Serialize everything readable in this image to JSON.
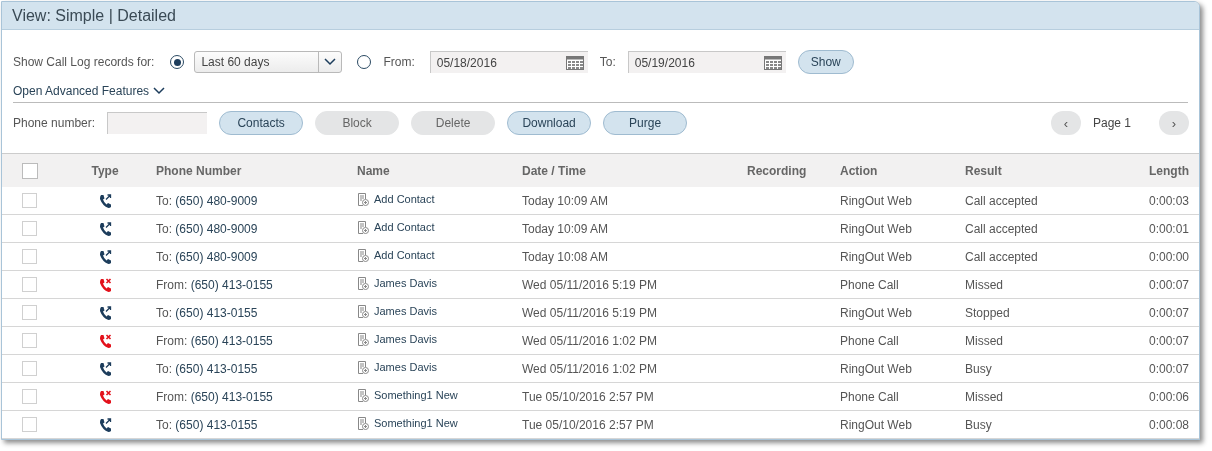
{
  "header": {
    "title": "View: Simple | Detailed"
  },
  "filter": {
    "label": "Show Call Log records for:",
    "range_selected": true,
    "range": "Last 60 days",
    "from_selected": false,
    "from_label": "From:",
    "from": "05/18/2016",
    "to_label": "To:",
    "to": "05/19/2016",
    "show": "Show"
  },
  "advanced": {
    "label": "Open Advanced Features"
  },
  "toolbar": {
    "phone_label": "Phone number:",
    "buttons": [
      {
        "label": "Contacts",
        "disabled": false
      },
      {
        "label": "Block",
        "disabled": true
      },
      {
        "label": "Delete",
        "disabled": true
      },
      {
        "label": "Download",
        "disabled": false
      },
      {
        "label": "Purge",
        "disabled": false
      }
    ],
    "page": "Page 1",
    "prev": "‹",
    "next": "›",
    "prev_disabled": true,
    "next_disabled": true
  },
  "table": {
    "all_checked": false,
    "columns": [
      "Type",
      "Phone Number",
      "Name",
      "Date / Time",
      "Recording",
      "Action",
      "Result",
      "Length"
    ],
    "rows": [
      {
        "checked": false,
        "kind": "outgoing",
        "direction": "To:",
        "number": "(650) 480-9009",
        "name": "Add Contact",
        "datetime": "Today 10:09 AM",
        "action": "RingOut Web",
        "result": "Call accepted",
        "length": "0:00:03"
      },
      {
        "checked": false,
        "kind": "outgoing",
        "direction": "To:",
        "number": "(650) 480-9009",
        "name": "Add Contact",
        "datetime": "Today 10:09 AM",
        "action": "RingOut Web",
        "result": "Call accepted",
        "length": "0:00:01"
      },
      {
        "checked": false,
        "kind": "outgoing",
        "direction": "To:",
        "number": "(650) 480-9009",
        "name": "Add Contact",
        "datetime": "Today 10:08 AM",
        "action": "RingOut Web",
        "result": "Call accepted",
        "length": "0:00:00"
      },
      {
        "checked": false,
        "kind": "missed",
        "direction": "From:",
        "number": "(650) 413-0155",
        "name": "James Davis",
        "datetime": "Wed 05/11/2016 5:19 PM",
        "action": "Phone Call",
        "result": "Missed",
        "length": "0:00:07"
      },
      {
        "checked": false,
        "kind": "outgoing",
        "direction": "To:",
        "number": "(650) 413-0155",
        "name": "James Davis",
        "datetime": "Wed 05/11/2016 5:19 PM",
        "action": "RingOut Web",
        "result": "Stopped",
        "length": "0:00:07"
      },
      {
        "checked": false,
        "kind": "missed",
        "direction": "From:",
        "number": "(650) 413-0155",
        "name": "James Davis",
        "datetime": "Wed 05/11/2016 1:02 PM",
        "action": "Phone Call",
        "result": "Missed",
        "length": "0:00:07"
      },
      {
        "checked": false,
        "kind": "outgoing",
        "direction": "To:",
        "number": "(650) 413-0155",
        "name": "James Davis",
        "datetime": "Wed 05/11/2016 1:02 PM",
        "action": "RingOut Web",
        "result": "Busy",
        "length": "0:00:07"
      },
      {
        "checked": false,
        "kind": "missed",
        "direction": "From:",
        "number": "(650) 413-0155",
        "name": "Something1 New",
        "datetime": "Tue 05/10/2016 2:57 PM",
        "action": "Phone Call",
        "result": "Missed",
        "length": "0:00:06"
      },
      {
        "checked": false,
        "kind": "outgoing",
        "direction": "To:",
        "number": "(650) 413-0155",
        "name": "Something1 New",
        "datetime": "Tue 05/10/2016 2:57 PM",
        "action": "RingOut Web",
        "result": "Busy",
        "length": "0:00:08"
      }
    ]
  }
}
